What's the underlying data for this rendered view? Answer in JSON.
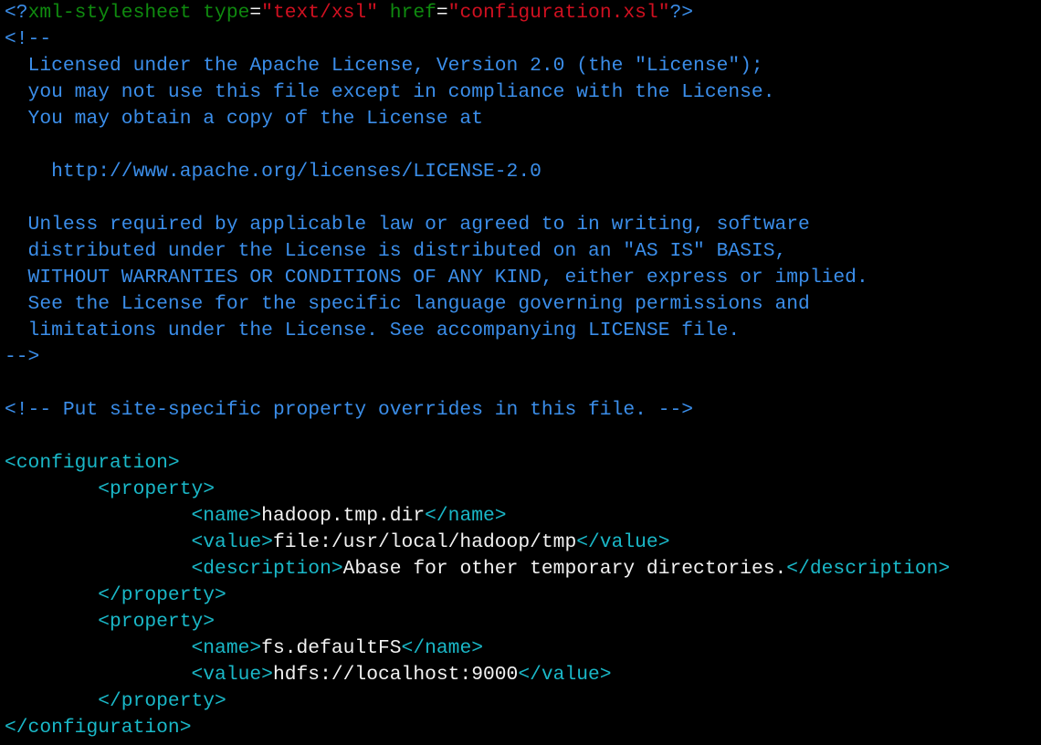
{
  "colors": {
    "comment": "#3b8eea",
    "pi": "#0f8a0f",
    "str": "#d01020",
    "tag": "#1ab8c8",
    "text": "#f2f2f2",
    "background": "#000000"
  },
  "lines": [
    [
      [
        "<?",
        "comment"
      ],
      [
        "xml-stylesheet type",
        "pi"
      ],
      [
        "=",
        "text"
      ],
      [
        "\"text/xsl\"",
        "str"
      ],
      [
        " href",
        "pi"
      ],
      [
        "=",
        "text"
      ],
      [
        "\"configuration.xsl\"",
        "str"
      ],
      [
        "?>",
        "comment"
      ]
    ],
    [
      [
        "<!--",
        "comment"
      ]
    ],
    [
      [
        "  Licensed under the Apache License, Version 2.0 (the \"License\");",
        "comment"
      ]
    ],
    [
      [
        "  you may not use this file except in compliance with the License.",
        "comment"
      ]
    ],
    [
      [
        "  You may obtain a copy of the License at",
        "comment"
      ]
    ],
    [],
    [
      [
        "    http://www.apache.org/licenses/LICENSE-2.0",
        "comment"
      ]
    ],
    [],
    [
      [
        "  Unless required by applicable law or agreed to in writing, software",
        "comment"
      ]
    ],
    [
      [
        "  distributed under the License is distributed on an \"AS IS\" BASIS,",
        "comment"
      ]
    ],
    [
      [
        "  WITHOUT WARRANTIES OR CONDITIONS OF ANY KIND, either express or implied.",
        "comment"
      ]
    ],
    [
      [
        "  See the License for the specific language governing permissions and",
        "comment"
      ]
    ],
    [
      [
        "  limitations under the License. See accompanying LICENSE file.",
        "comment"
      ]
    ],
    [
      [
        "-->",
        "comment"
      ]
    ],
    [],
    [
      [
        "<!-- Put site-specific property overrides in this file. -->",
        "comment"
      ]
    ],
    [],
    [
      [
        "<configuration>",
        "tag"
      ]
    ],
    [
      [
        "        <property>",
        "tag"
      ]
    ],
    [
      [
        "                <name>",
        "tag"
      ],
      [
        "hadoop.tmp.dir",
        "text"
      ],
      [
        "</name>",
        "tag"
      ]
    ],
    [
      [
        "                <value>",
        "tag"
      ],
      [
        "file:/usr/local/hadoop/tmp",
        "text"
      ],
      [
        "</value>",
        "tag"
      ]
    ],
    [
      [
        "                <description>",
        "tag"
      ],
      [
        "Abase for other temporary directories.",
        "text"
      ],
      [
        "</description>",
        "tag"
      ]
    ],
    [
      [
        "        </property>",
        "tag"
      ]
    ],
    [
      [
        "        <property>",
        "tag"
      ]
    ],
    [
      [
        "                <name>",
        "tag"
      ],
      [
        "fs.defaultFS",
        "text"
      ],
      [
        "</name>",
        "tag"
      ]
    ],
    [
      [
        "                <value>",
        "tag"
      ],
      [
        "hdfs://localhost:9000",
        "text"
      ],
      [
        "</value>",
        "tag"
      ]
    ],
    [
      [
        "        </property>",
        "tag"
      ]
    ],
    [
      [
        "</configuration>",
        "tag"
      ]
    ]
  ]
}
